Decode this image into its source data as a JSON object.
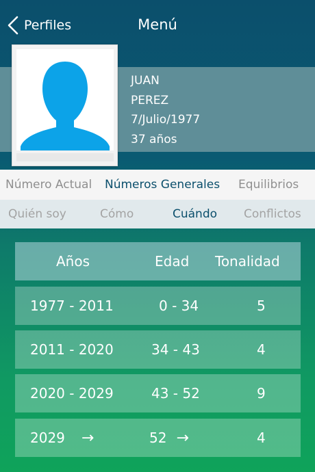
{
  "nav": {
    "back_label": "Perfiles",
    "title": "Menú"
  },
  "profile": {
    "first_name": "JUAN",
    "last_name": "PEREZ",
    "birth_date": "7/Julio/1977",
    "age": "37 años"
  },
  "tabs_primary": [
    {
      "label": "Número Actual",
      "active": false
    },
    {
      "label": "Números Generales",
      "active": true
    },
    {
      "label": "Equilibrios",
      "active": false
    }
  ],
  "tabs_secondary": [
    {
      "label": "Quién soy",
      "active": false
    },
    {
      "label": "Cómo",
      "active": false
    },
    {
      "label": "Cuándo",
      "active": true
    },
    {
      "label": "Conflictos",
      "active": false
    }
  ],
  "table": {
    "headers": [
      "Años",
      "Edad",
      "Tonalidad"
    ],
    "rows": [
      {
        "years": "1977 - 2011",
        "age": "0 - 34",
        "tone": "5"
      },
      {
        "years": "2011 - 2020",
        "age": "34 - 43",
        "tone": "4"
      },
      {
        "years": "2020 - 2029",
        "age": "43 - 52",
        "tone": "9"
      },
      {
        "years": "2029",
        "years_arrow": "→",
        "age": "52",
        "age_arrow": "→",
        "tone": "4"
      }
    ]
  },
  "colors": {
    "nav_bg": "#0b4f6c",
    "profile_band": "#5f8e98",
    "active_tab": "#0b4f6c",
    "inactive_tab": "#8f8f8f",
    "silhouette": "#0ca3e8"
  },
  "icons": {
    "back": "chevron-left-icon",
    "avatar": "person-silhouette-icon"
  }
}
